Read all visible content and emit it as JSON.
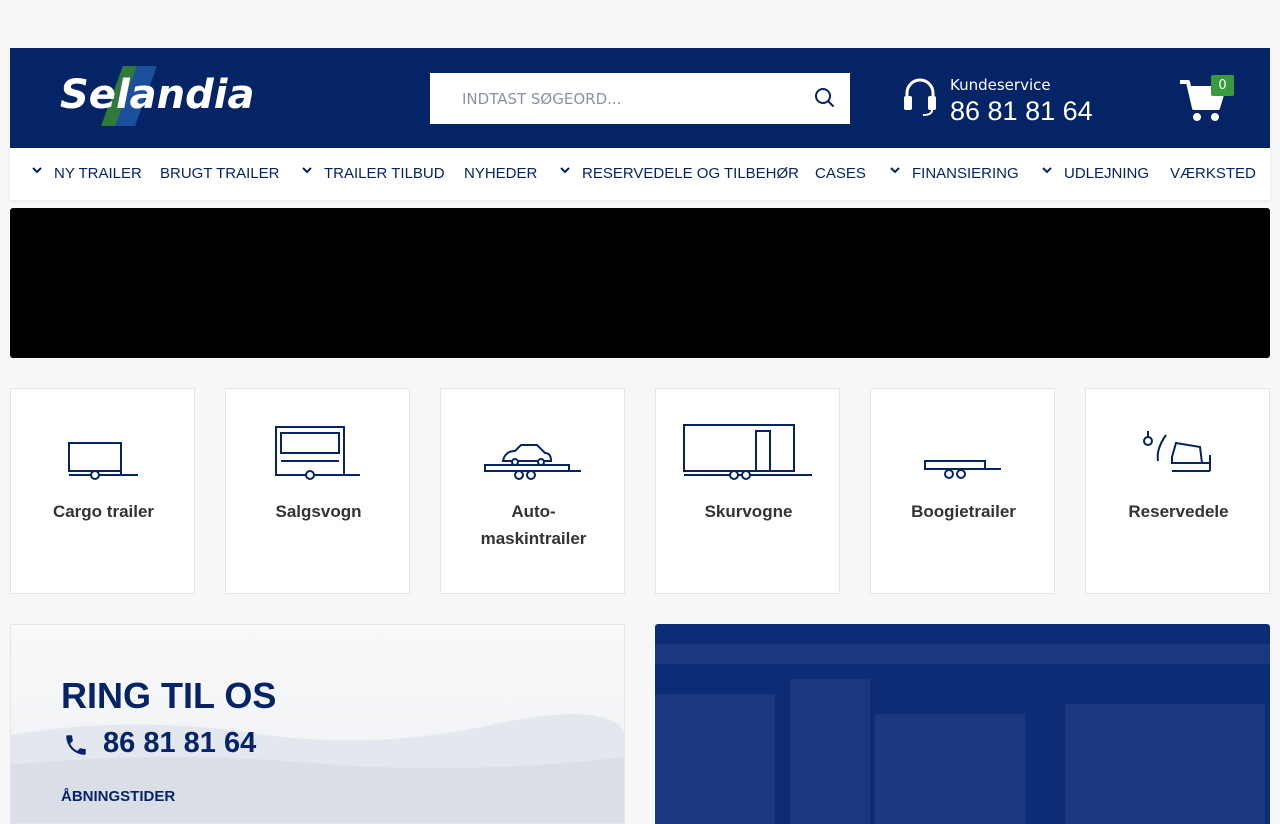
{
  "brand": {
    "logo_text": "Selandia",
    "primary_color": "#052466",
    "accent_green": "#3a9b3d"
  },
  "search": {
    "placeholder": "INDTAST SØGEORD..."
  },
  "customer_service": {
    "label": "Kundeservice",
    "phone": "86 81 81 64"
  },
  "cart": {
    "count": "0"
  },
  "nav": {
    "items": [
      {
        "label": "NY TRAILER",
        "dropdown": true
      },
      {
        "label": "BRUGT TRAILER",
        "dropdown": false
      },
      {
        "label": "TRAILER TILBUD",
        "dropdown": true
      },
      {
        "label": "NYHEDER",
        "dropdown": false
      },
      {
        "label": "RESERVEDELE OG TILBEHØR",
        "dropdown": true
      },
      {
        "label": "CASES",
        "dropdown": false
      },
      {
        "label": "FINANSIERING",
        "dropdown": true
      },
      {
        "label": "UDLEJNING",
        "dropdown": true
      },
      {
        "label": "VÆRKSTED",
        "dropdown": false
      }
    ]
  },
  "categories": [
    {
      "label": "Cargo trailer",
      "icon": "cargo-trailer-icon"
    },
    {
      "label": "Salgsvogn",
      "icon": "sales-wagon-icon"
    },
    {
      "label": "Auto-maskintrailer",
      "label_line1": "Auto-",
      "label_line2": "maskintrailer",
      "icon": "car-transporter-icon"
    },
    {
      "label": "Skurvogne",
      "icon": "site-hut-trailer-icon"
    },
    {
      "label": "Boogietrailer",
      "icon": "boogie-trailer-icon"
    },
    {
      "label": "Reservedele",
      "icon": "spare-parts-icon"
    }
  ],
  "call_box": {
    "title": "RING TIL OS",
    "phone": "86 81 81 64",
    "hours_label": "ÅBNINGSTIDER"
  }
}
